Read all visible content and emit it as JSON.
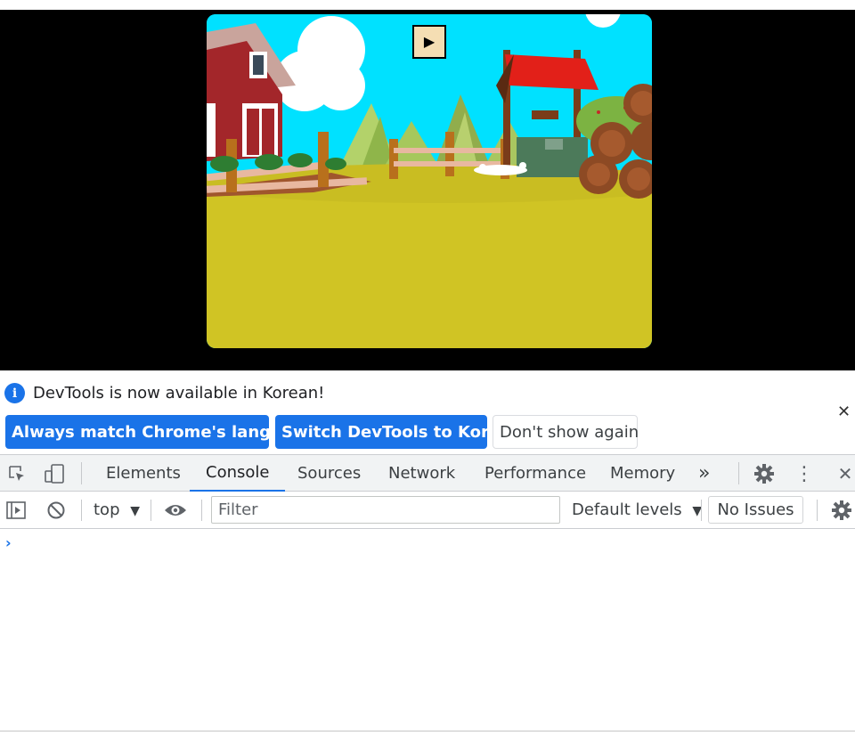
{
  "viewport": {
    "game": {
      "play_button_glyph": "▶",
      "colors": {
        "sky": "#00e1ff",
        "ground": "#d0c424",
        "barn": "#a3262a",
        "roof": "#e22019"
      }
    }
  },
  "infobar": {
    "message": "DevTools is now available in Korean!",
    "info_icon": "i",
    "buttons": {
      "always_match": "Always match Chrome's language",
      "switch": "Switch DevTools to Korean",
      "dont_show": "Don't show again"
    },
    "close_glyph": "✕"
  },
  "devtools": {
    "tabs": [
      "Elements",
      "Console",
      "Sources",
      "Network",
      "Performance",
      "Memory"
    ],
    "active_tab": "Console",
    "more_tabs_glyph": "»",
    "close_glyph": "✕",
    "menu_glyph": "⋮"
  },
  "console": {
    "context": "top",
    "context_arrow": "▼",
    "filter_placeholder": "Filter",
    "levels": "Default levels",
    "levels_arrow": "▼",
    "issues": "No Issues",
    "prompt": "›"
  },
  "colors": {
    "accent": "#1a73e8",
    "toolbar_bg": "#f1f3f4"
  }
}
